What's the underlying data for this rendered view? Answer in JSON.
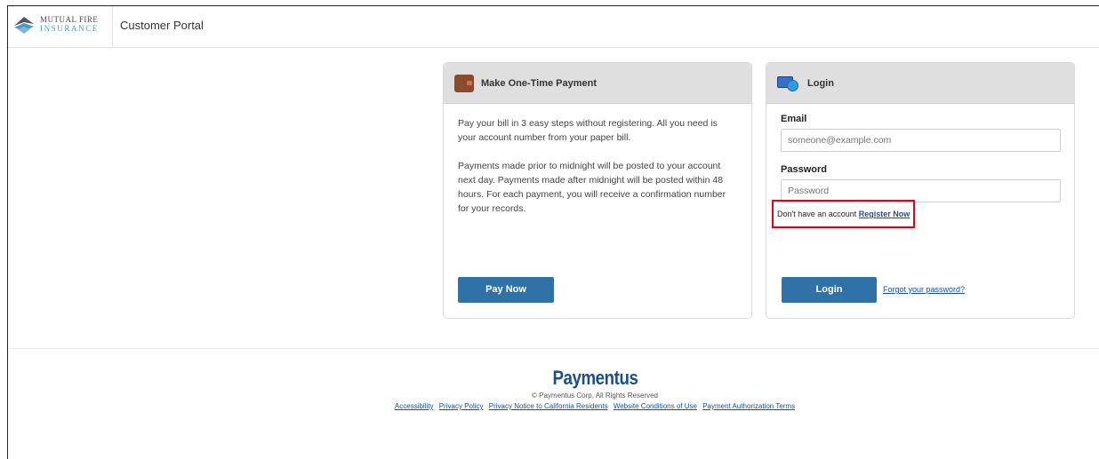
{
  "header": {
    "logo_line1": "MUTUAL FIRE",
    "logo_line2": "INSURANCE",
    "portal_title": "Customer Portal"
  },
  "payment": {
    "title": "Make One-Time Payment",
    "icon": "wallet-icon",
    "paragraph1": "Pay your bill in 3 easy steps without registering. All you need is your account number from your paper bill.",
    "paragraph2": "Payments made prior to midnight will be posted to your account next day. Payments made after midnight will be posted within 48 hours. For each payment, you will receive a confirmation number for your records.",
    "button_label": "Pay Now"
  },
  "login": {
    "title": "Login",
    "icon": "login-icon",
    "email_label": "Email",
    "email_placeholder": "someone@example.com",
    "email_value": "",
    "password_label": "Password",
    "password_placeholder": "Password",
    "password_value": "",
    "register_prompt": "Don't have an account",
    "register_link": "Register Now",
    "button_label": "Login",
    "forgot_link": "Forgot your password?"
  },
  "footer": {
    "brand": "Paymentus",
    "copyright": "© Paymentus Corp, All Rights Reserved",
    "links": [
      "Accessibility",
      "Privacy Policy",
      "Privacy Notice to California Residents",
      "Website Conditions of Use",
      "Payment Authorization Terms"
    ]
  },
  "colors": {
    "primary_button": "#2e72a7",
    "link": "#1a4f8f",
    "highlight_box": "#e4001b",
    "card_header": "#dfdfdf"
  }
}
